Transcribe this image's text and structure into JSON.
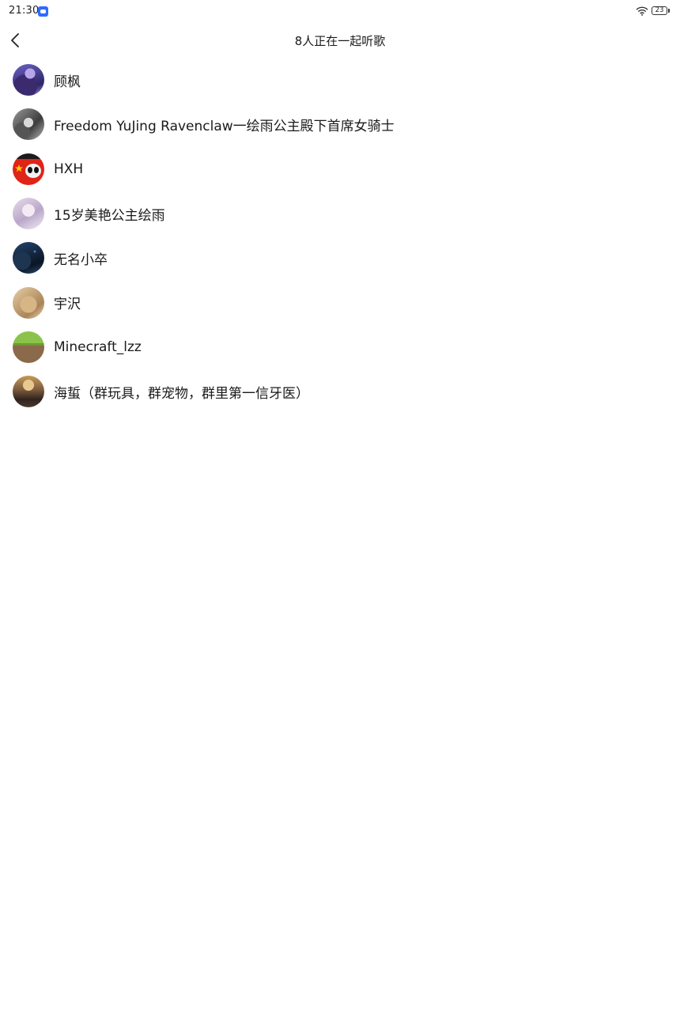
{
  "status_bar": {
    "time": "21:30",
    "app_icon": "chat-app-icon",
    "wifi_icon": "wifi-icon",
    "battery": "23"
  },
  "header": {
    "back_icon": "chevron-left-icon",
    "title": "8人正在一起听歌"
  },
  "members": [
    {
      "name": "顾枫"
    },
    {
      "name": "Freedom YuJing Ravenclaw一绘雨公主殿下首席女骑士"
    },
    {
      "name": "HXH"
    },
    {
      "name": "15岁美艳公主绘雨"
    },
    {
      "name": "无名小卒"
    },
    {
      "name": "宇沢"
    },
    {
      "name": "Minecraft_lzz"
    },
    {
      "name": "海蜇（群玩具，群宠物，群里第一信牙医）"
    }
  ]
}
